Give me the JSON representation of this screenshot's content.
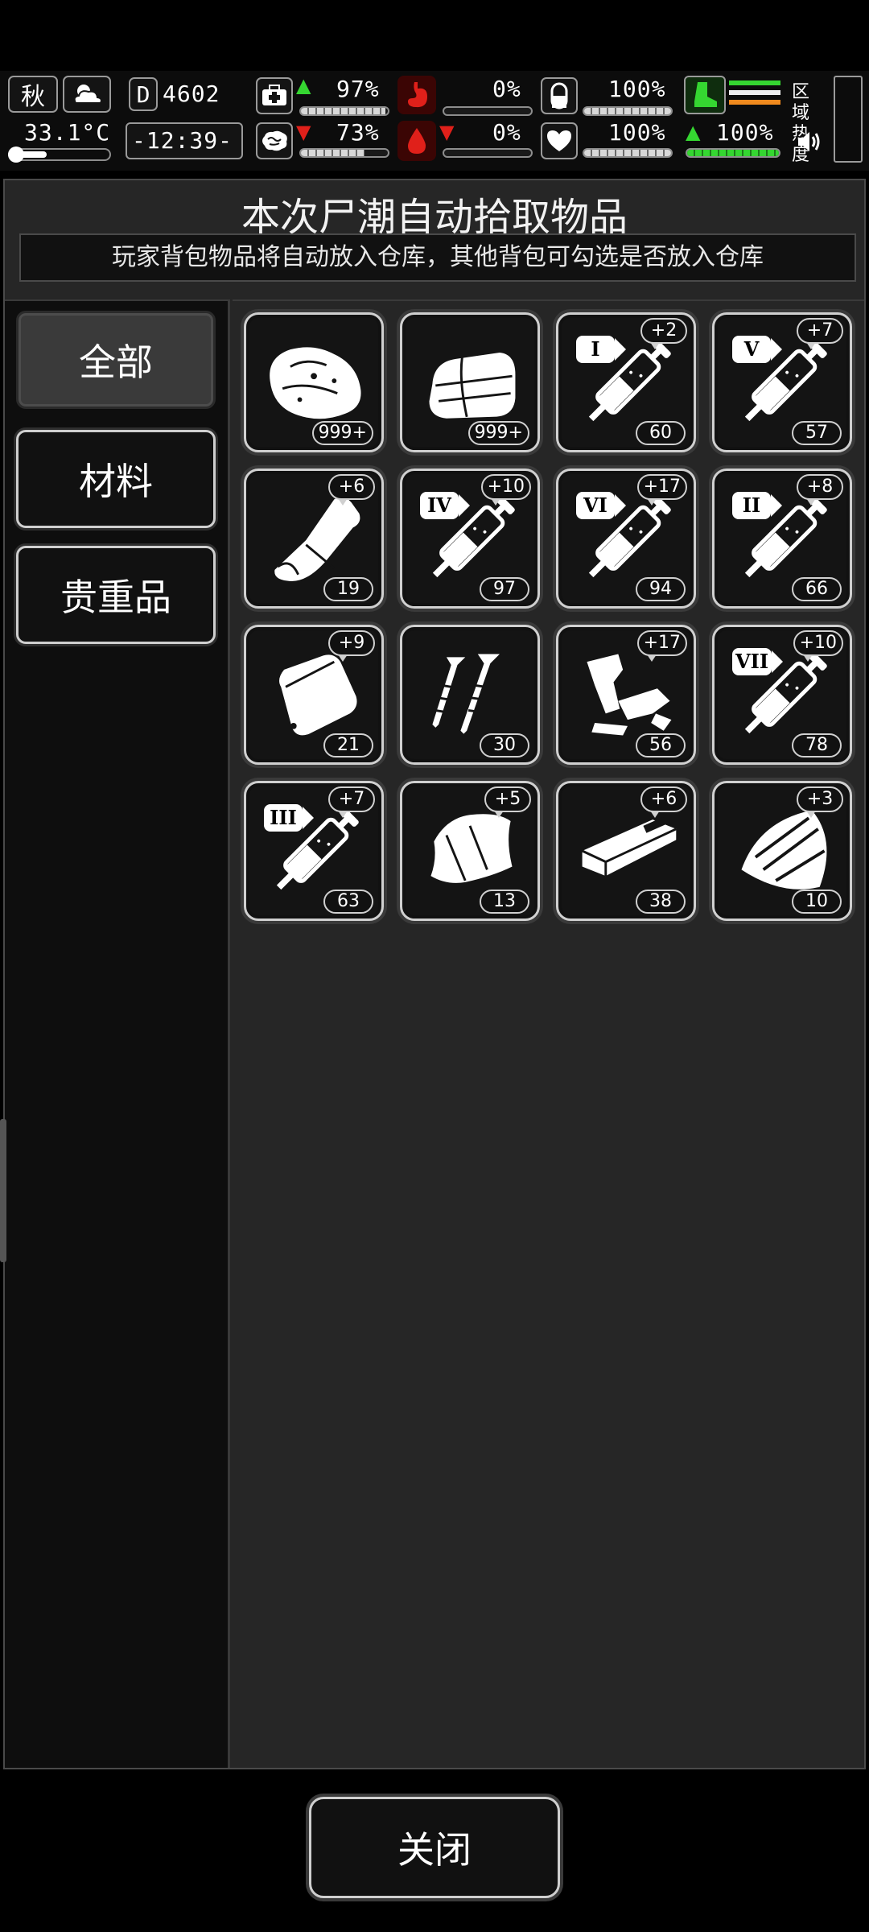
{
  "hud": {
    "season": "秋",
    "temperature": "33.1°C",
    "day_counter": "4602",
    "day_prefix": "D",
    "clock": "-12:39-",
    "stats_row1": [
      {
        "icon": "first-aid-icon",
        "arrow": "up",
        "value": "97%",
        "level": 0.97
      },
      {
        "icon": "stomach-icon",
        "arrow": "none",
        "value": "0%",
        "level": 0.0
      },
      {
        "icon": "pill-icon",
        "arrow": "none",
        "value": "100%",
        "level": 1.0
      }
    ],
    "stats_row2": [
      {
        "icon": "brain-icon",
        "arrow": "down",
        "value": "73%",
        "level": 0.73
      },
      {
        "icon": "blood-drop-icon",
        "arrow": "down",
        "value": "0%",
        "level": 0.0
      },
      {
        "icon": "heart-icon",
        "arrow": "none",
        "value": "100%",
        "level": 1.0
      }
    ],
    "stamina": {
      "icon": "boot-icon",
      "arrow": "up",
      "value": "100%",
      "level": 1.0
    },
    "zone_heat_label": "区域热度",
    "accent_green": "#35d631",
    "accent_red": "#e0201a"
  },
  "panel": {
    "title": "本次尸潮自动拾取物品",
    "subtitle": "玩家背包物品将自动放入仓库，其他背包可勾选是否放入仓库"
  },
  "categories": [
    {
      "label": "全部",
      "active": true
    },
    {
      "label": "材料",
      "active": false
    },
    {
      "label": "贵重品",
      "active": false
    }
  ],
  "items": [
    {
      "name": "raw-meat",
      "icon": "meat-icon",
      "count": "999+",
      "bonus": "",
      "roman": ""
    },
    {
      "name": "cloth",
      "icon": "cloth-icon",
      "count": "999+",
      "bonus": "",
      "roman": ""
    },
    {
      "name": "syringe-1",
      "icon": "syringe-icon",
      "count": "60",
      "bonus": "+2",
      "roman": "I"
    },
    {
      "name": "syringe-5",
      "icon": "syringe-icon",
      "count": "57",
      "bonus": "+7",
      "roman": "V"
    },
    {
      "name": "bandage-roll",
      "icon": "bandage-icon",
      "count": "19",
      "bonus": "+6",
      "roman": ""
    },
    {
      "name": "syringe-4",
      "icon": "syringe-icon",
      "count": "97",
      "bonus": "+10",
      "roman": "IV"
    },
    {
      "name": "syringe-6",
      "icon": "syringe-icon",
      "count": "94",
      "bonus": "+17",
      "roman": "VI"
    },
    {
      "name": "syringe-2",
      "icon": "syringe-icon",
      "count": "66",
      "bonus": "+8",
      "roman": "II"
    },
    {
      "name": "pouch",
      "icon": "pouch-icon",
      "count": "21",
      "bonus": "+9",
      "roman": ""
    },
    {
      "name": "screws",
      "icon": "screw-icon",
      "count": "30",
      "bonus": "",
      "roman": ""
    },
    {
      "name": "scrap-parts",
      "icon": "scrap-icon",
      "count": "56",
      "bonus": "+17",
      "roman": ""
    },
    {
      "name": "syringe-7",
      "icon": "syringe-icon",
      "count": "78",
      "bonus": "+10",
      "roman": "VII"
    },
    {
      "name": "syringe-3",
      "icon": "syringe-icon",
      "count": "63",
      "bonus": "+7",
      "roman": "III"
    },
    {
      "name": "leather",
      "icon": "leather-icon",
      "count": "13",
      "bonus": "+5",
      "roman": ""
    },
    {
      "name": "wood-plank",
      "icon": "plank-icon",
      "count": "38",
      "bonus": "+6",
      "roman": ""
    },
    {
      "name": "bark",
      "icon": "bark-icon",
      "count": "10",
      "bonus": "+3",
      "roman": ""
    }
  ],
  "footer": {
    "close_label": "关闭"
  }
}
